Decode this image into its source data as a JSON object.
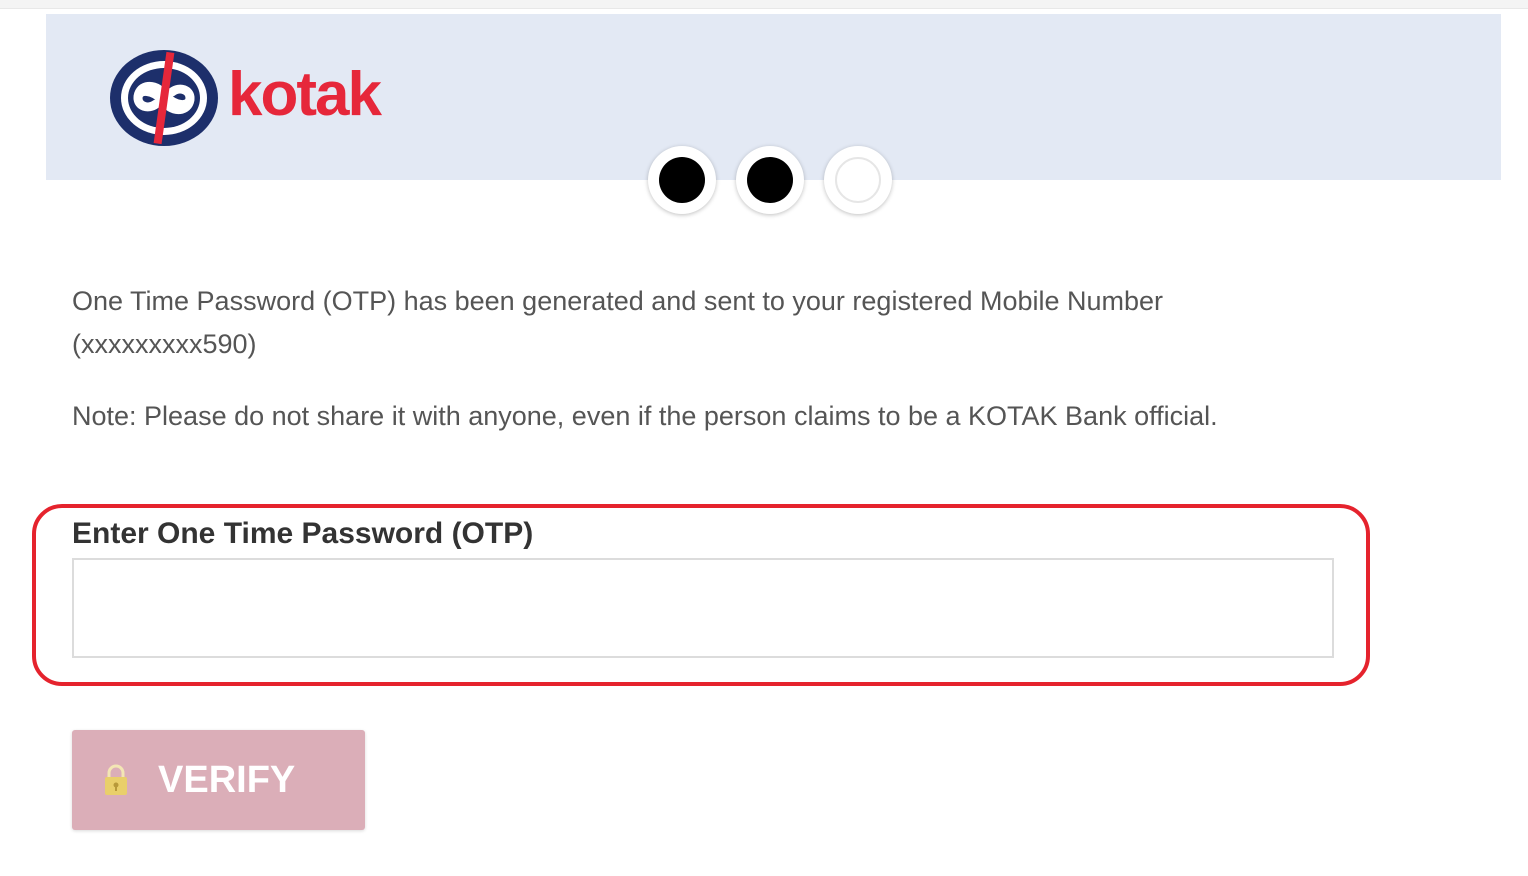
{
  "header": {
    "logo_text": "kotak",
    "brand_colors": {
      "logo_circle": "#1d2f6b",
      "logo_text": "#e6273a",
      "band": "#e3e9f4"
    }
  },
  "progress": {
    "total_steps": 3,
    "completed_steps": 2
  },
  "content": {
    "message": "One Time Password (OTP) has been generated and sent to your registered Mobile Number (xxxxxxxxx590)",
    "note": "Note: Please do not share it with anyone, even if the person claims to be a KOTAK Bank official."
  },
  "otp_form": {
    "label": "Enter One Time Password (OTP)",
    "value": "",
    "placeholder": "",
    "highlight_color": "#e5232d"
  },
  "verify_button": {
    "label": "VERIFY",
    "icon": "lock-icon",
    "color": "#dbaeb8"
  }
}
